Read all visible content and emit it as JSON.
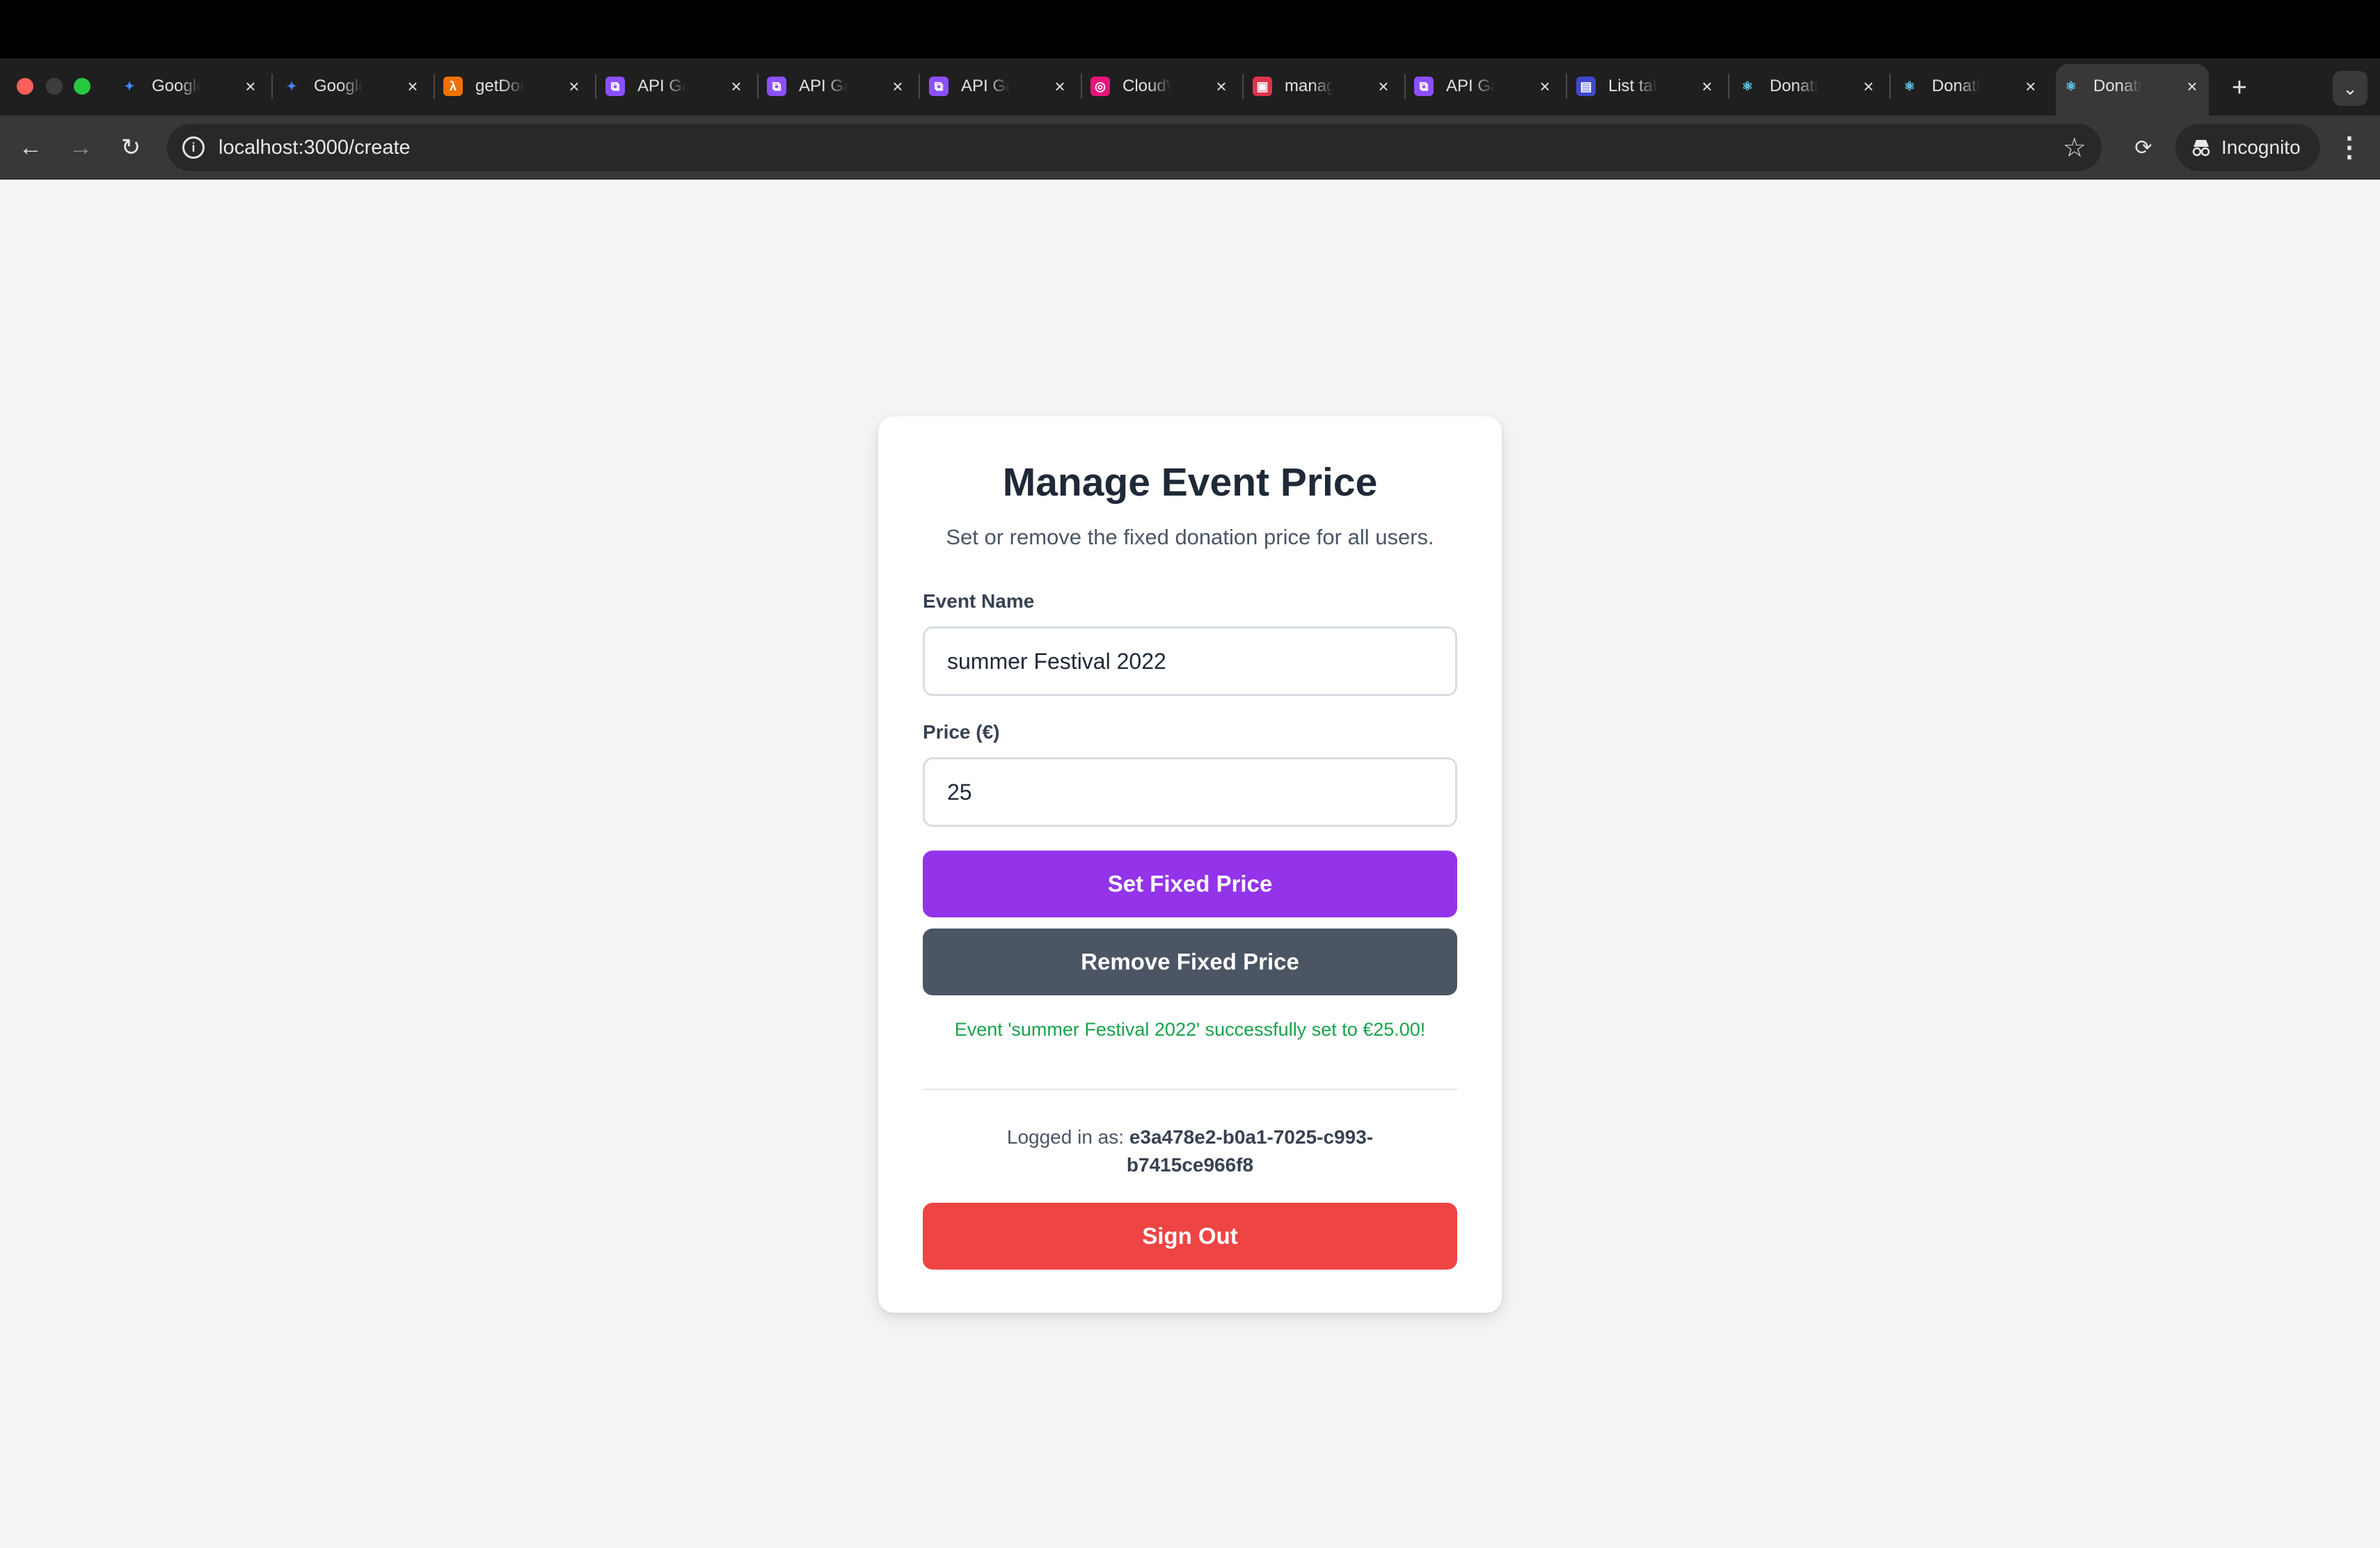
{
  "browser": {
    "tabs": [
      {
        "title": "Google Gemini",
        "icon": "gemini-icon",
        "color": "#4285f4"
      },
      {
        "title": "Google Gemini",
        "icon": "gemini-icon",
        "color": "#4285f4"
      },
      {
        "title": "getDonations",
        "icon": "aws-lambda-icon",
        "color": "#ed7100"
      },
      {
        "title": "API Gateway",
        "icon": "api-gateway-icon",
        "color": "#8c4fff"
      },
      {
        "title": "API Gateway",
        "icon": "api-gateway-icon",
        "color": "#8c4fff"
      },
      {
        "title": "API Gateway",
        "icon": "api-gateway-icon",
        "color": "#8c4fff"
      },
      {
        "title": "CloudWatch",
        "icon": "cloudwatch-icon",
        "color": "#e7157b"
      },
      {
        "title": "manage",
        "icon": "aws-service-icon",
        "color": "#dd344c"
      },
      {
        "title": "API Gateway",
        "icon": "api-gateway-icon",
        "color": "#8c4fff"
      },
      {
        "title": "List tables",
        "icon": "dynamodb-icon",
        "color": "#3f48cc"
      },
      {
        "title": "Donation",
        "icon": "react-icon",
        "color": "#61dafb"
      },
      {
        "title": "Donation",
        "icon": "react-icon",
        "color": "#61dafb"
      },
      {
        "title": "Donation",
        "icon": "react-icon",
        "color": "#61dafb",
        "active": true
      }
    ],
    "url": "localhost:3000/create",
    "incognito_label": "Incognito"
  },
  "card": {
    "title": "Manage Event Price",
    "subtitle": "Set or remove the fixed donation price for all users.",
    "event_name_label": "Event Name",
    "event_name_value": "summer Festival 2022",
    "price_label": "Price (€)",
    "price_value": "25",
    "set_button": "Set Fixed Price",
    "remove_button": "Remove Fixed Price",
    "success_message": "Event 'summer Festival 2022' successfully set to €25.00!",
    "logged_in_prefix": "Logged in as:",
    "user_id": "e3a478e2-b0a1-7025-c993-b7415ce966f8",
    "signout_button": "Sign Out"
  },
  "colors": {
    "primary": "#9333ea",
    "secondary": "#4b5563",
    "danger": "#ef4444",
    "success": "#16a34a",
    "page_bg": "#f3f4f6"
  }
}
